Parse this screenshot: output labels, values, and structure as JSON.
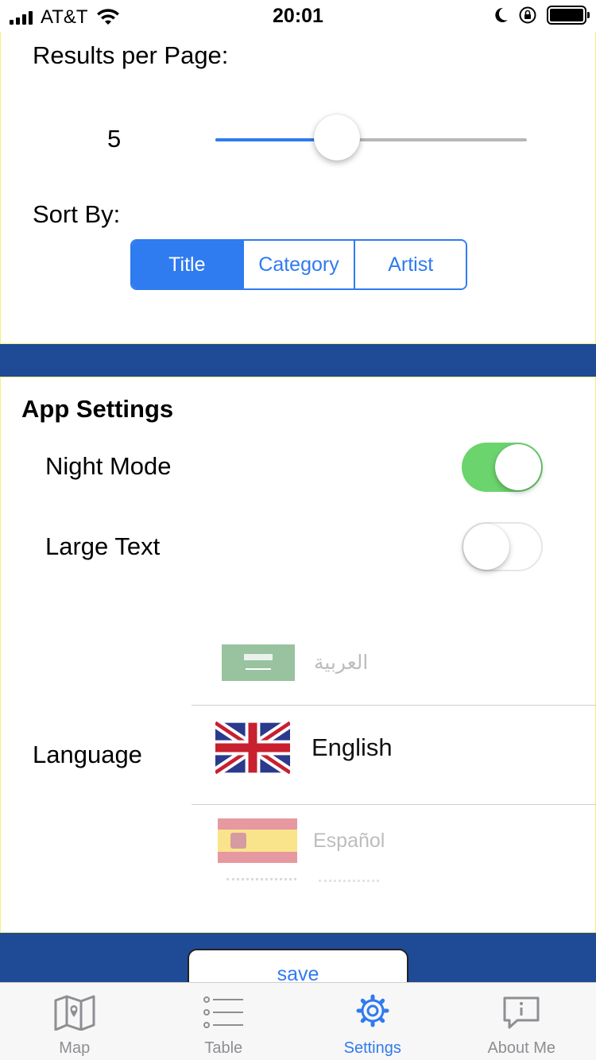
{
  "status_bar": {
    "carrier": "AT&T",
    "time": "20:01",
    "icons": [
      "signal-icon",
      "wifi-icon",
      "moon-icon",
      "orientation-lock-icon",
      "battery-icon"
    ]
  },
  "search_settings": {
    "results_label": "Results per Page:",
    "results_value": "5",
    "slider_fraction": 0.39,
    "sort_label": "Sort By:",
    "sort_options": [
      "Title",
      "Category",
      "Artist"
    ],
    "sort_selected": "Title"
  },
  "app_settings": {
    "title": "App Settings",
    "night_mode_label": "Night Mode",
    "night_mode_on": true,
    "large_text_label": "Large Text",
    "large_text_on": false,
    "language_label": "Language",
    "languages": [
      "العربية",
      "English",
      "Español"
    ],
    "language_selected": "English"
  },
  "save_label": "save",
  "tabs": [
    {
      "label": "Map",
      "icon": "map-icon"
    },
    {
      "label": "Table",
      "icon": "list-icon"
    },
    {
      "label": "Settings",
      "icon": "gear-icon"
    },
    {
      "label": "About Me",
      "icon": "info-bubble-icon"
    }
  ],
  "active_tab": "Settings",
  "colors": {
    "accent": "#2f7bf0",
    "toggle_on": "#6bd46d",
    "section_divider": "#1f4a96",
    "card_border": "#f2f27a",
    "tab_inactive": "#8e8e93"
  }
}
